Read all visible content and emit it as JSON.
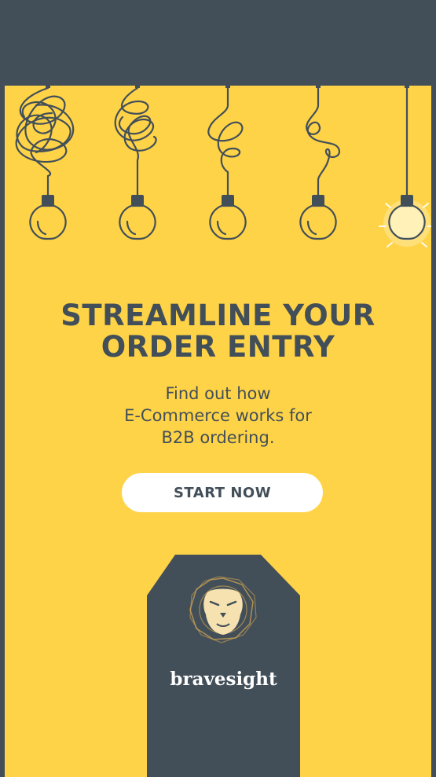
{
  "ad": {
    "headline_line1": "STREAMLINE YOUR",
    "headline_line2": "ORDER ENTRY",
    "sub_line1": "Find out how",
    "sub_line2": "E-Commerce works for",
    "sub_line3": "B2B ordering.",
    "cta_label": "START NOW"
  },
  "brand": {
    "name": "bravesight"
  },
  "colors": {
    "background_yellow": "#ffd347",
    "slate": "#424f59",
    "button": "#ffffff",
    "lion_gold": "#c9a052"
  },
  "icons": [
    "lightbulb-icon",
    "lion-logo-icon"
  ]
}
